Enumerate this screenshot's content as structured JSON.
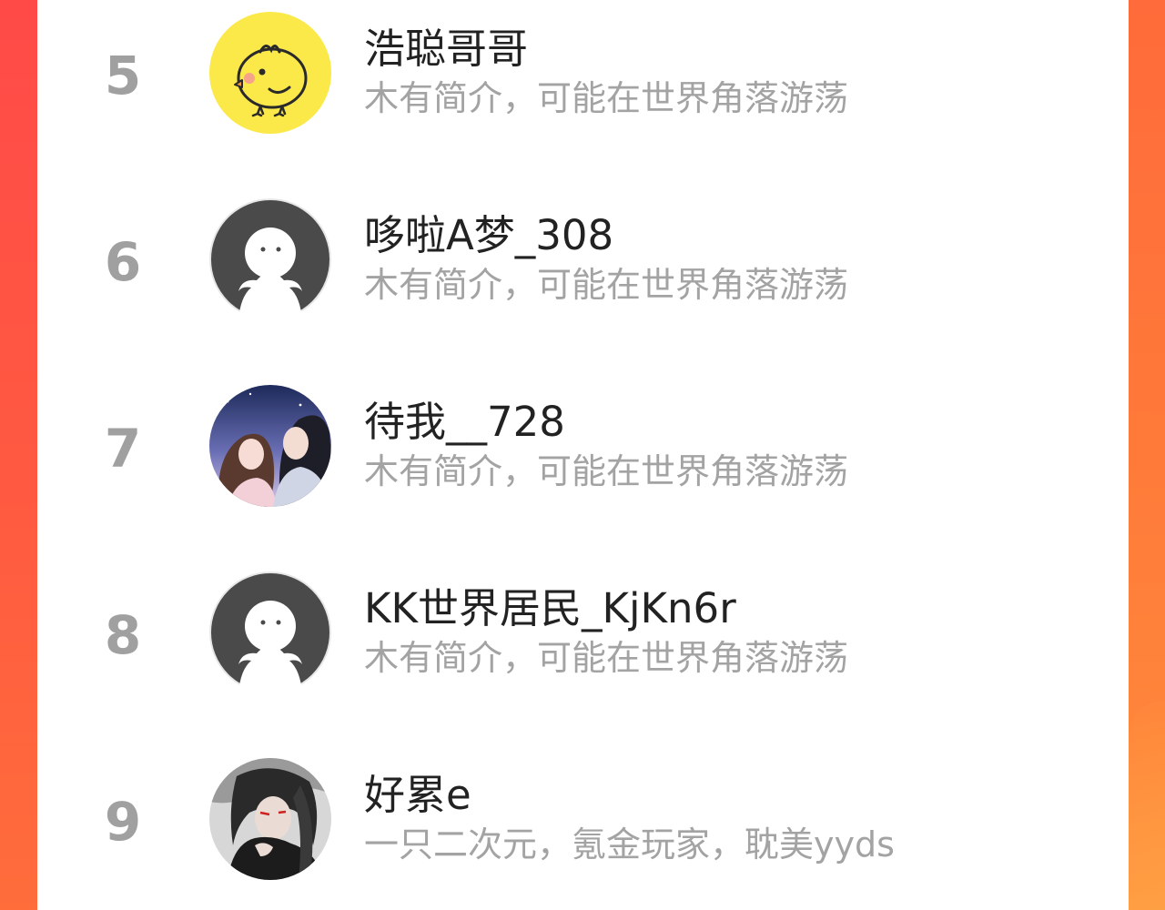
{
  "colors": {
    "background_gradient_start": "#ff5a45",
    "background_gradient_end": "#ff8a3d",
    "panel": "#ffffff",
    "rank_text": "#a0a0a0",
    "name_text": "#222222",
    "bio_text": "#a3a3a3"
  },
  "leaderboard": {
    "items": [
      {
        "rank": "5",
        "name": "浩聪哥哥",
        "bio": "木有简介，可能在世界角落游荡",
        "avatar": "yellow-chick-avatar"
      },
      {
        "rank": "6",
        "name": "哆啦A梦_308",
        "bio": "木有简介，可能在世界角落游荡",
        "avatar": "default-ghost-avatar"
      },
      {
        "rank": "7",
        "name": "待我__728",
        "bio": "木有简介，可能在世界角落游荡",
        "avatar": "anime-couple-avatar"
      },
      {
        "rank": "8",
        "name": "KK世界居民_KjKn6r",
        "bio": "木有简介，可能在世界角落游荡",
        "avatar": "default-ghost-avatar"
      },
      {
        "rank": "9",
        "name": "好累e",
        "bio": "一只二次元，氪金玩家，耽美yyds",
        "avatar": "anime-boy-avatar"
      }
    ]
  }
}
